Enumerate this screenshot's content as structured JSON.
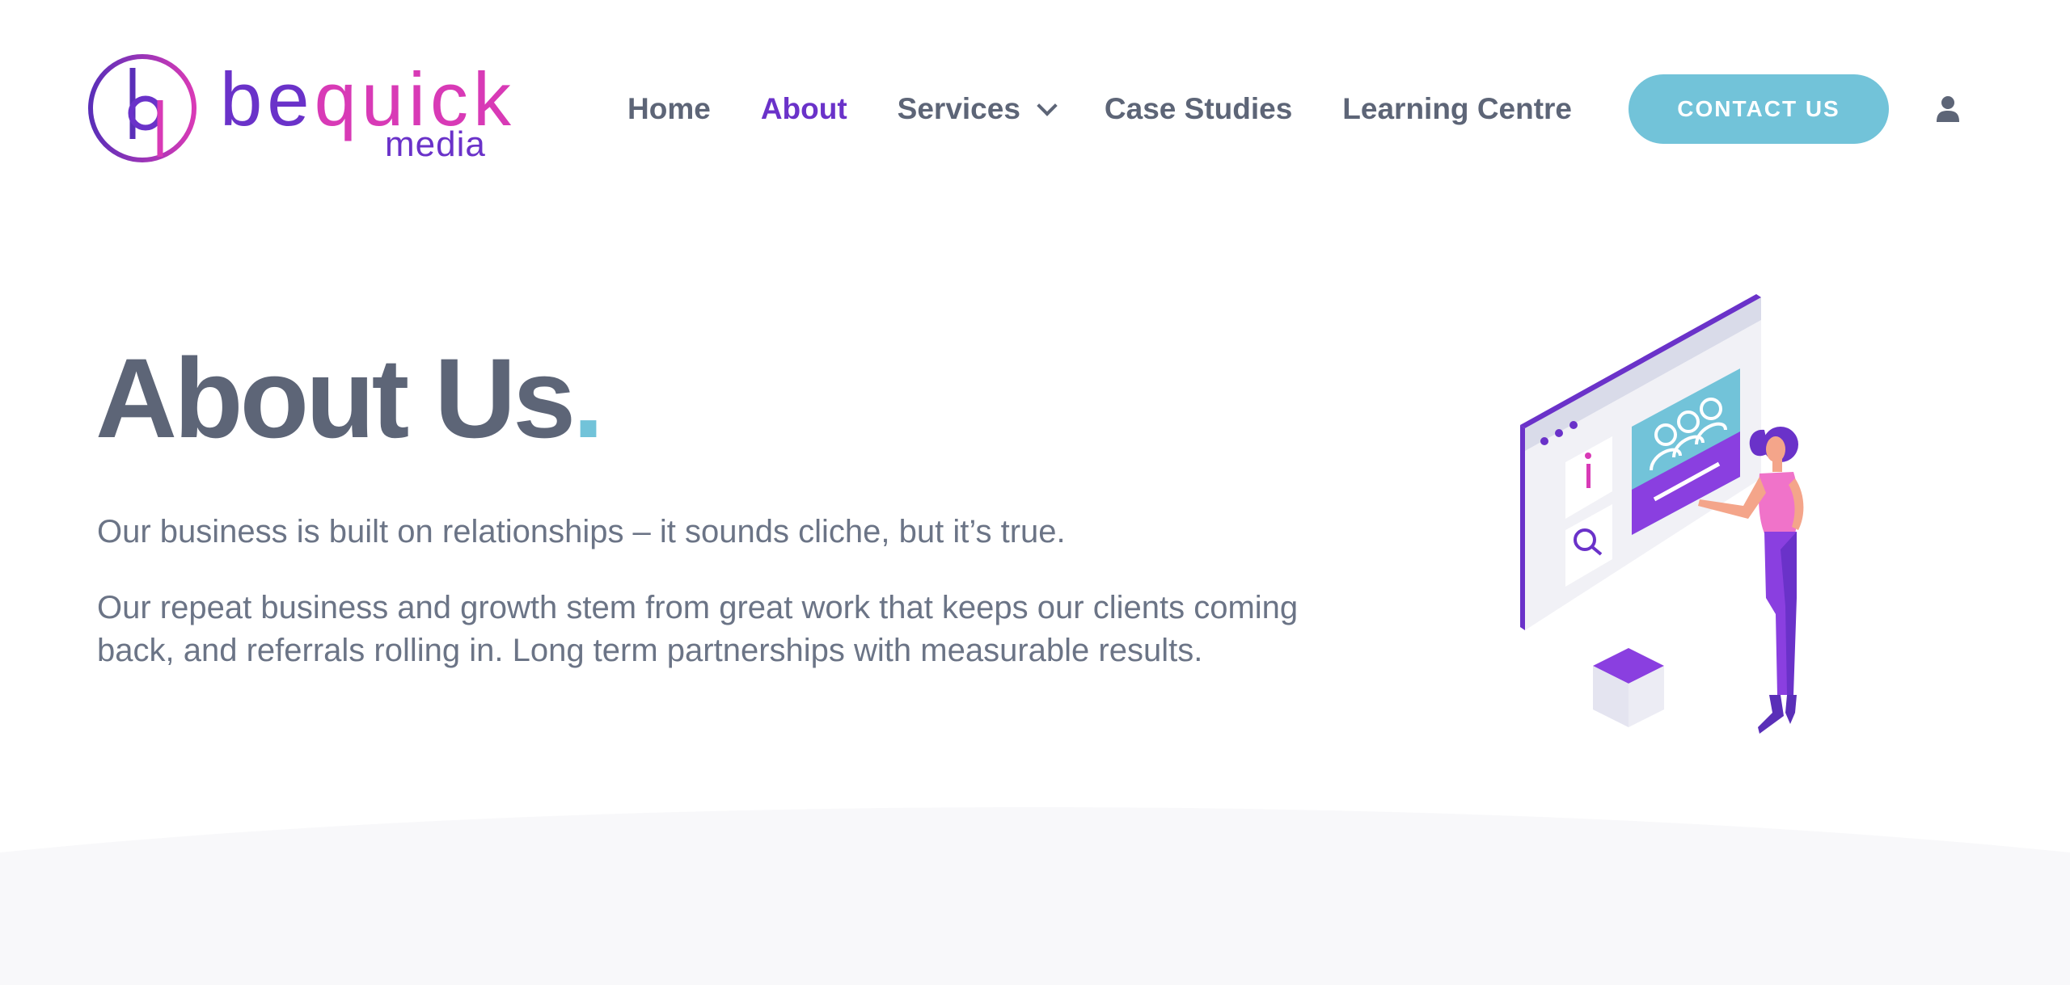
{
  "brand": {
    "logo_part1": "be",
    "logo_part2": "quick",
    "logo_sub": "media",
    "primary_color": "#6a32c9",
    "pink_color": "#d83ab6",
    "accent_color": "#72c3d9"
  },
  "nav": {
    "items": [
      {
        "label": "Home",
        "active": false
      },
      {
        "label": "About",
        "active": true
      },
      {
        "label": "Services",
        "active": false,
        "has_dropdown": true
      },
      {
        "label": "Case Studies",
        "active": false
      },
      {
        "label": "Learning Centre",
        "active": false
      }
    ],
    "contact_label": "CONTACT US",
    "account_icon": "user-icon"
  },
  "hero": {
    "title": "About Us",
    "title_dot": ".",
    "paragraph1": "Our business is built on relationships – it sounds cliche, but it’s true.",
    "paragraph2": "Our repeat business and growth stem from great work that keeps our clients coming back, and referrals rolling in. Long term partnerships with measurable results.",
    "illustration_icon": "woman-at-screen-illustration"
  }
}
